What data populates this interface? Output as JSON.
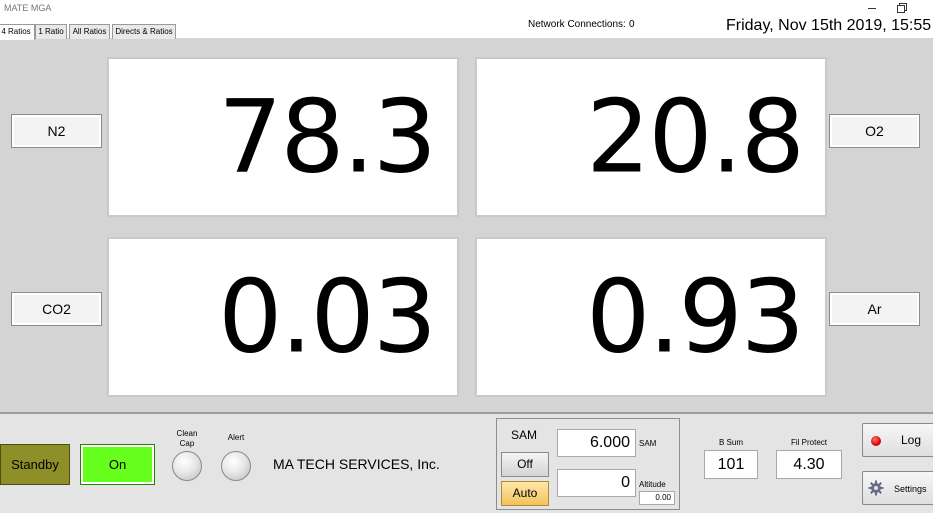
{
  "window": {
    "title": "MATE MGA"
  },
  "tabs": [
    {
      "label": "4 Ratios",
      "active": true
    },
    {
      "label": "1 Ratio",
      "active": false
    },
    {
      "label": "All Ratios",
      "active": false
    },
    {
      "label": "Directs & Ratios",
      "active": false
    }
  ],
  "header": {
    "network_label": "Network Connections:",
    "network_count": "0",
    "datetime": "Friday, Nov 15th 2019, 15:55"
  },
  "readouts": [
    {
      "gas": "N2",
      "value": "78.3"
    },
    {
      "gas": "O2",
      "value": "20.8"
    },
    {
      "gas": "CO2",
      "value": "0.03"
    },
    {
      "gas": "Ar",
      "value": "0.93"
    }
  ],
  "controls": {
    "standby_label": "Standby",
    "on_label": "On",
    "clean_cap_label": "Clean Cap",
    "alert_label": "Alert",
    "company": "MA TECH SERVICES, Inc."
  },
  "sam": {
    "title": "SAM",
    "off_label": "Off",
    "auto_label": "Auto",
    "value": "6.000",
    "unit_label": "SAM",
    "altitude_value": "0",
    "altitude_label": "Altitude",
    "altitude_sub": "0.00"
  },
  "status": {
    "bsum_label": "B Sum",
    "bsum_value": "101",
    "fil_label": "Fil Protect",
    "fil_value": "4.30"
  },
  "side_buttons": {
    "log_label": "Log",
    "settings_label": "Settings"
  },
  "colors": {
    "on_button": "#66ff1e",
    "standby_button": "#8f8f2a",
    "auto_button": "#f2c35b",
    "log_indicator": "#e00000"
  },
  "icons": {
    "log_indicator": "red-dot-icon",
    "settings": "gear-icon"
  }
}
